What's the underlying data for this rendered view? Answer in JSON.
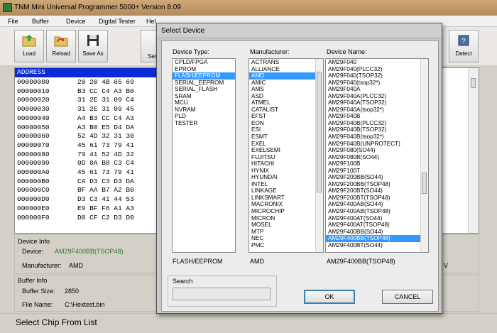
{
  "window": {
    "title": "TNM Mini Universal Programmer 5000+   Version 8.09"
  },
  "menu": [
    "File",
    "Buffer",
    "Device",
    "Digital Tester",
    "Help"
  ],
  "toolbar": {
    "load": "Load",
    "reload": "Reload",
    "saveas": "Save As",
    "setup_partial": "Set",
    "detect": "Detect"
  },
  "hex": {
    "header": "ADDRESS",
    "rows": [
      {
        "addr": "00000000",
        "bytes": "20 20 4B 65 69"
      },
      {
        "addr": "00000010",
        "bytes": "B3 CC C4 A3 B0"
      },
      {
        "addr": "00000020",
        "bytes": "31 2E 31 09 C4"
      },
      {
        "addr": "00000030",
        "bytes": "31 2E 31 09 45"
      },
      {
        "addr": "00000040",
        "bytes": "A4 B3 CC C4 A3"
      },
      {
        "addr": "00000050",
        "bytes": "A3 B0 E5 D4 DA"
      },
      {
        "addr": "00000060",
        "bytes": "52 4D 32 31 30"
      },
      {
        "addr": "00000070",
        "bytes": "45 61 73 79 41"
      },
      {
        "addr": "00000080",
        "bytes": "79 41 52 4D 32"
      },
      {
        "addr": "00000090",
        "bytes": "0D 0A B8 C3 C4"
      },
      {
        "addr": "000000A0",
        "bytes": "45 61 73 79 41"
      },
      {
        "addr": "000000B0",
        "bytes": "CA D3 C3 D3 DA"
      },
      {
        "addr": "000000C0",
        "bytes": "BF AA B7 A2 B0"
      },
      {
        "addr": "000000D0",
        "bytes": "D3 C3 41 44 53"
      },
      {
        "addr": "000000E0",
        "bytes": "E9 BF F6 A1 A3"
      },
      {
        "addr": "000000F0",
        "bytes": "D0 CF C2 D3 D0"
      }
    ]
  },
  "device_info": {
    "group": "Device Info",
    "device_label": "Device:",
    "device_value": "AM29F400BB(TSOP48)",
    "manufacturer_label": "Manufacturer:",
    "manufacturer_value": "AMD",
    "right_partial": "V"
  },
  "buffer_info": {
    "group": "Buffer Info",
    "size_label": "Buffer Size:",
    "size_value": "2850",
    "file_label": "File Name:",
    "file_value": "C:\\Hextest.bin"
  },
  "status": "Select Chip From List",
  "dialog": {
    "title": "Select Device",
    "device_type_label": "Device Type:",
    "manufacturer_label": "Manufacturer:",
    "device_name_label": "Device Name:",
    "device_types": [
      "CPLD/FPGA",
      "EPROM",
      "FLASH/EEPROM",
      "SERIAL_EEPROM",
      "SERIAL_FLASH",
      "SRAM",
      "MCU",
      "NVRAM",
      "PLD",
      "TESTER"
    ],
    "device_type_selected": 2,
    "manufacturers": [
      "ACTRANS",
      "ALLIANCE",
      "AMD",
      "AMIC",
      "AMS",
      "ASD",
      "ATMEL",
      "CATALIST",
      "EFST",
      "EON",
      "ESI",
      "ESMT",
      "EXEL",
      "EXELSEMI",
      "FUJITSU",
      "HITACHI",
      "HYNIX",
      "HYUNDAI",
      "INTEL",
      "LINKAGE",
      "LINKSMART",
      "MACRONIX",
      "MICROCHIP",
      "MICRON",
      "MOSEL",
      "MTP",
      "NEC",
      "PMC"
    ],
    "manufacturer_selected": 2,
    "device_names": [
      "AM29F040",
      "AM29F040(PLCC32)",
      "AM29F040(TSOP32)",
      "AM29F040(tsop32*)",
      "AM29F040A",
      "AM29F040A(PLCC32)",
      "AM29F040A(TSOP32)",
      "AM29F040A(tsop32*)",
      "AM29F040B",
      "AM29F040B(PLCC32)",
      "AM29F040B(TSOP32)",
      "AM29F040B(tsop32*)",
      "AM29F040B(UNPROTECT)",
      "AM29F080(SO44)",
      "AM29F080B(SO44)",
      "AM29F100B",
      "AM29F100T",
      "AM29F200BB(SO44)",
      "AM29F200BB(TSOP48)",
      "AM29F200BT(SO44)",
      "AM29F200BT(TSOP48)",
      "AM29F400AB(SO44)",
      "AM29F400AB(TSOP48)",
      "AM29F400AT(SO44)",
      "AM29F400AT(TSOP48)",
      "AM29F400BB(SO44)",
      "AM29F400BB(TSOP48)",
      "AM29F400BT(SO44)"
    ],
    "device_name_selected": 26,
    "selected_type_text": "FLASH/EEPROM",
    "selected_manufacturer_text": "AMD",
    "selected_device_text": "AM29F400BB(TSOP48)",
    "search_label": "Search",
    "search_value": "",
    "ok": "OK",
    "cancel": "CANCEL"
  }
}
